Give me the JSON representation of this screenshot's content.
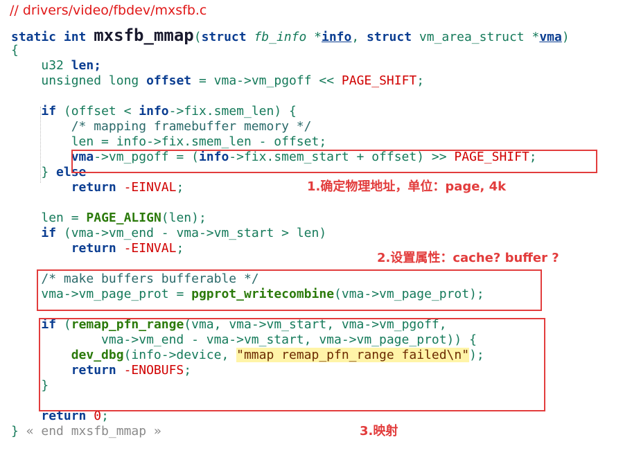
{
  "file_path": "// drivers/video/fbdev/mxsfb.c",
  "code": {
    "sig_static": "static",
    "sig_int": "int",
    "sig_name": "mxsfb_mmap",
    "sig_open": "(",
    "sig_struct1": "struct",
    "sig_fbinfo": "fb_info",
    "sig_star1": "*",
    "sig_info": "info",
    "sig_comma": ",",
    "sig_struct2": "struct",
    "sig_vmstruct": "vm_area_struct",
    "sig_star2": "*",
    "sig_vma": "vma",
    "sig_close": ")",
    "open_brace": "{",
    "l1_type": "u32",
    "l1_var": "len;",
    "l2_type": "unsigned long",
    "l2_var": "offset",
    "l2_eq": "=",
    "l2_rhs": "vma->vm_pgoff <<",
    "l2_mac": "PAGE_SHIFT",
    "l2_end": ";",
    "l3_if": "if",
    "l3_cond": "(offset <",
    "l3_info": "info",
    "l3_rest": "->fix.smem_len) {",
    "l4_comment": "/* mapping framebuffer memory */",
    "l5_text": "len = info->fix.smem_len - offset;",
    "l6_a": "vma",
    "l6_b": "->vm_pgoff = (",
    "l6_info": "info",
    "l6_c": "->fix.smem_start + offset) >>",
    "l6_mac": "PAGE_SHIFT",
    "l6_end": ";",
    "l7_brace": "}",
    "l7_else": "else",
    "l8_return": "return",
    "l8_val": "-EINVAL",
    "l8_end": ";",
    "l9_len": "len",
    "l9_eq": "=",
    "l9_fn": "PAGE_ALIGN",
    "l9_args": "(len);",
    "l10_if": "if",
    "l10_cond": "(vma->vm_end - vma->vm_start > len)",
    "l11_return": "return",
    "l11_val": "-EINVAL",
    "l11_end": ";",
    "l12_comment": "/* make buffers bufferable */",
    "l13_lhs": "vma->vm_page_prot",
    "l13_eq": "=",
    "l13_fn": "pgprot_writecombine",
    "l13_args": "(vma->vm_page_prot);",
    "l14_if": "if",
    "l14_open": "(",
    "l14_fn": "remap_pfn_range",
    "l14_args": "(vma, vma->vm_start, vma->vm_pgoff,",
    "l15_args": "vma->vm_end - vma->vm_start, vma->vm_page_prot))",
    "l15_brace": "{",
    "l16_fn": "dev_dbg",
    "l16_args": "(info->device,",
    "l16_str": "\"mmap remap_pfn_range failed\\n\"",
    "l16_end": ");",
    "l17_return": "return",
    "l17_val": "-ENOBUFS",
    "l17_end": ";",
    "l18_brace": "}",
    "l19_return": "return",
    "l19_num": "0",
    "l19_end": ";",
    "close_brace": "}",
    "fold_text": "« end mxsfb_mmap »"
  },
  "annotations": {
    "note1": "1.确定物理地址，单位：page, 4k",
    "note2": "2.设置属性：cache? buffer ?",
    "note3": "3.映射"
  },
  "colors": {
    "annotation_red": "#e23c3c",
    "keyword_blue": "#0a3d91",
    "identifier_teal": "#157a5a",
    "macro_red": "#d00000",
    "string_highlight": "#fff4a8"
  }
}
